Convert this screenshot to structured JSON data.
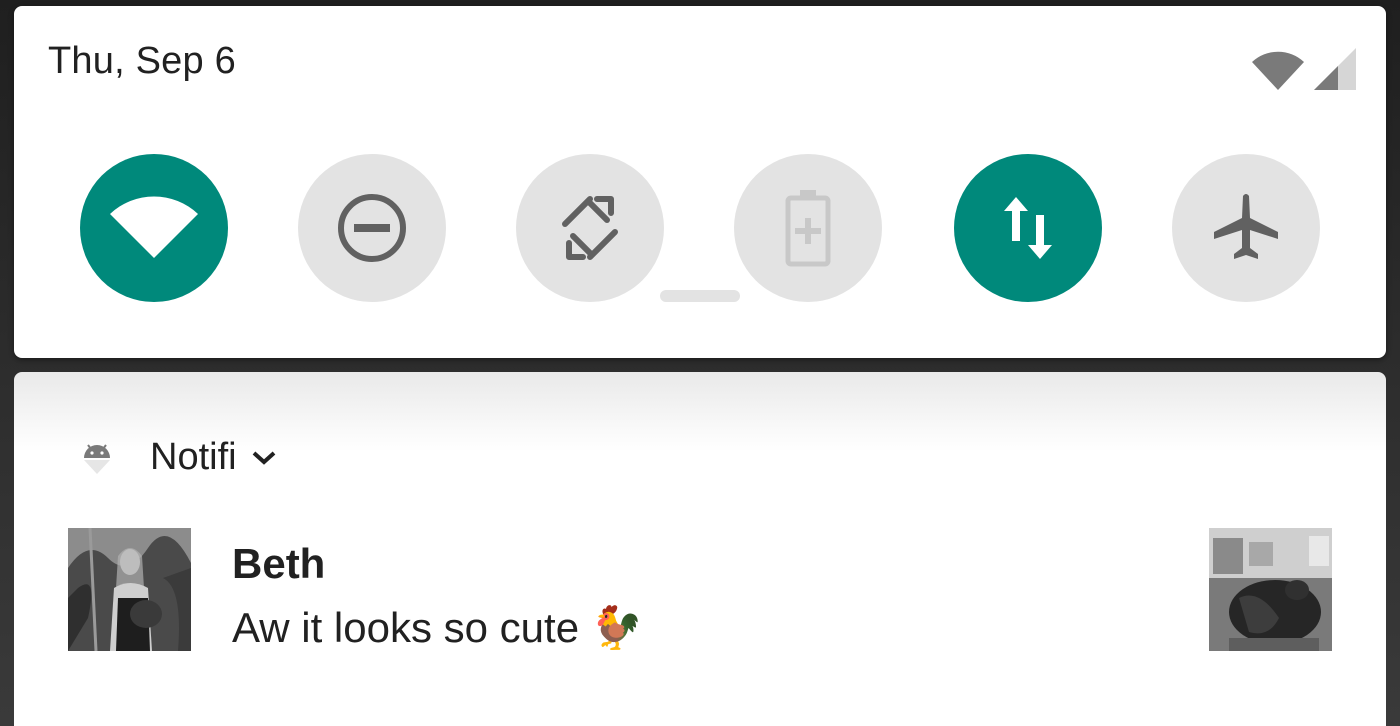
{
  "quick_settings": {
    "date": "Thu, Sep 6",
    "accent_color": "#00897b",
    "inactive_color": "#e3e3e3",
    "tiles": [
      {
        "icon": "wifi-icon",
        "active": true
      },
      {
        "icon": "do-not-disturb-icon",
        "active": false
      },
      {
        "icon": "auto-rotate-icon",
        "active": false
      },
      {
        "icon": "battery-saver-icon",
        "active": false
      },
      {
        "icon": "mobile-data-icon",
        "active": true
      },
      {
        "icon": "airplane-mode-icon",
        "active": false
      }
    ],
    "status_icons": [
      "wifi-signal-icon",
      "cell-signal-icon"
    ]
  },
  "notification": {
    "app_icon": "android-icon",
    "app_name": "Notifi",
    "sender": "Beth",
    "message": "Aw it looks so cute 🐓",
    "avatar": "avatar-photo",
    "attachment": "chicken-photo"
  }
}
